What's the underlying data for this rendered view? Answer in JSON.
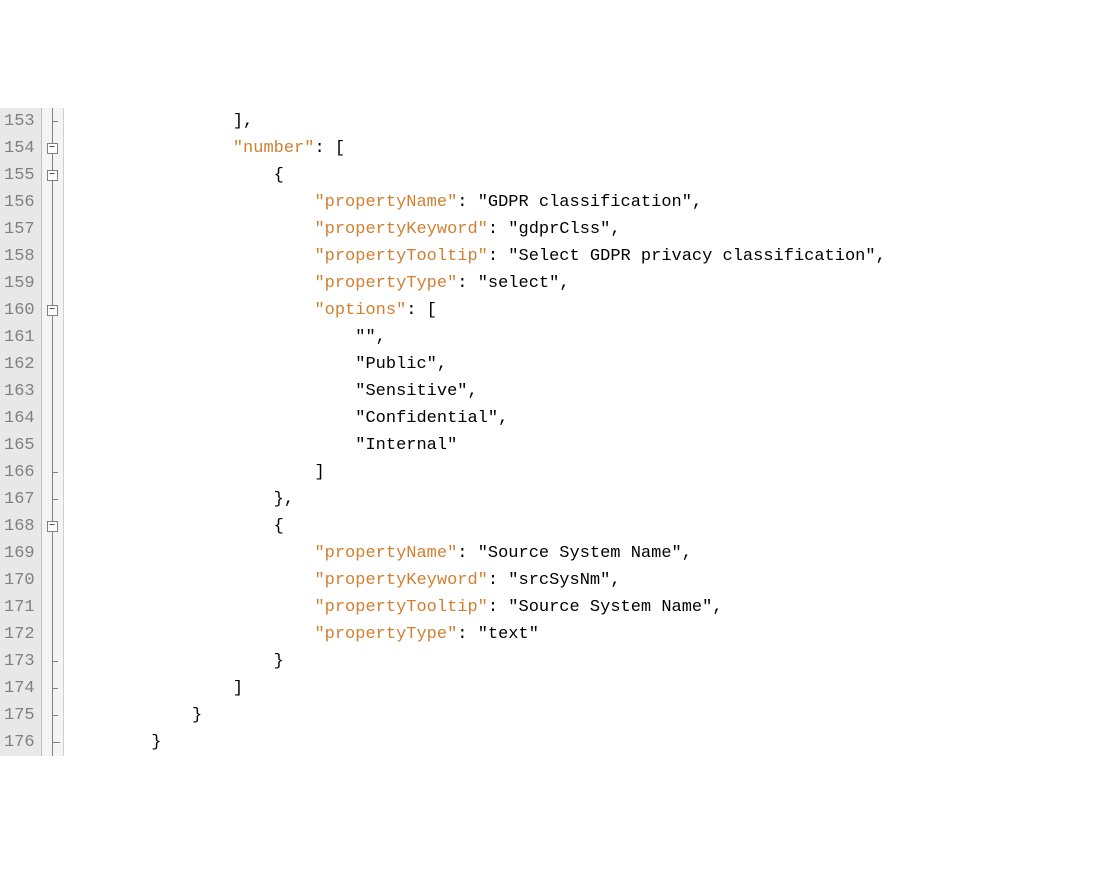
{
  "lines": [
    {
      "num": 153,
      "fold": "tick",
      "indent": 16,
      "tokens": [
        {
          "t": "punct",
          "v": "],"
        }
      ]
    },
    {
      "num": 154,
      "fold": "box",
      "indent": 16,
      "tokens": [
        {
          "t": "key",
          "v": "\"number\""
        },
        {
          "t": "punct",
          "v": ": ["
        }
      ]
    },
    {
      "num": 155,
      "fold": "box",
      "indent": 20,
      "tokens": [
        {
          "t": "punct",
          "v": "{"
        }
      ]
    },
    {
      "num": 156,
      "fold": "line",
      "indent": 24,
      "tokens": [
        {
          "t": "key",
          "v": "\"propertyName\""
        },
        {
          "t": "punct",
          "v": ": "
        },
        {
          "t": "string",
          "v": "\"GDPR classification\""
        },
        {
          "t": "punct",
          "v": ","
        }
      ]
    },
    {
      "num": 157,
      "fold": "line",
      "indent": 24,
      "tokens": [
        {
          "t": "key",
          "v": "\"propertyKeyword\""
        },
        {
          "t": "punct",
          "v": ": "
        },
        {
          "t": "string",
          "v": "\"gdprClss\""
        },
        {
          "t": "punct",
          "v": ","
        }
      ]
    },
    {
      "num": 158,
      "fold": "line",
      "indent": 24,
      "tokens": [
        {
          "t": "key",
          "v": "\"propertyTooltip\""
        },
        {
          "t": "punct",
          "v": ": "
        },
        {
          "t": "string",
          "v": "\"Select GDPR privacy classification\""
        },
        {
          "t": "punct",
          "v": ","
        }
      ]
    },
    {
      "num": 159,
      "fold": "line",
      "indent": 24,
      "tokens": [
        {
          "t": "key",
          "v": "\"propertyType\""
        },
        {
          "t": "punct",
          "v": ": "
        },
        {
          "t": "string",
          "v": "\"select\""
        },
        {
          "t": "punct",
          "v": ","
        }
      ]
    },
    {
      "num": 160,
      "fold": "box",
      "indent": 24,
      "tokens": [
        {
          "t": "key",
          "v": "\"options\""
        },
        {
          "t": "punct",
          "v": ": ["
        }
      ]
    },
    {
      "num": 161,
      "fold": "line",
      "indent": 28,
      "tokens": [
        {
          "t": "string",
          "v": "\"\""
        },
        {
          "t": "punct",
          "v": ","
        }
      ]
    },
    {
      "num": 162,
      "fold": "line",
      "indent": 28,
      "tokens": [
        {
          "t": "string",
          "v": "\"Public\""
        },
        {
          "t": "punct",
          "v": ","
        }
      ]
    },
    {
      "num": 163,
      "fold": "line",
      "indent": 28,
      "tokens": [
        {
          "t": "string",
          "v": "\"Sensitive\""
        },
        {
          "t": "punct",
          "v": ","
        }
      ]
    },
    {
      "num": 164,
      "fold": "line",
      "indent": 28,
      "tokens": [
        {
          "t": "string",
          "v": "\"Confidential\""
        },
        {
          "t": "punct",
          "v": ","
        }
      ]
    },
    {
      "num": 165,
      "fold": "line",
      "indent": 28,
      "tokens": [
        {
          "t": "string",
          "v": "\"Internal\""
        }
      ]
    },
    {
      "num": 166,
      "fold": "tick",
      "indent": 24,
      "tokens": [
        {
          "t": "punct",
          "v": "]"
        }
      ]
    },
    {
      "num": 167,
      "fold": "tick",
      "indent": 20,
      "tokens": [
        {
          "t": "punct",
          "v": "},"
        }
      ]
    },
    {
      "num": 168,
      "fold": "box",
      "indent": 20,
      "tokens": [
        {
          "t": "punct",
          "v": "{"
        }
      ]
    },
    {
      "num": 169,
      "fold": "line",
      "indent": 24,
      "tokens": [
        {
          "t": "key",
          "v": "\"propertyName\""
        },
        {
          "t": "punct",
          "v": ": "
        },
        {
          "t": "string",
          "v": "\"Source System Name\""
        },
        {
          "t": "punct",
          "v": ","
        }
      ]
    },
    {
      "num": 170,
      "fold": "line",
      "indent": 24,
      "tokens": [
        {
          "t": "key",
          "v": "\"propertyKeyword\""
        },
        {
          "t": "punct",
          "v": ": "
        },
        {
          "t": "string",
          "v": "\"srcSysNm\""
        },
        {
          "t": "punct",
          "v": ","
        }
      ]
    },
    {
      "num": 171,
      "fold": "line",
      "indent": 24,
      "tokens": [
        {
          "t": "key",
          "v": "\"propertyTooltip\""
        },
        {
          "t": "punct",
          "v": ": "
        },
        {
          "t": "string",
          "v": "\"Source System Name\""
        },
        {
          "t": "punct",
          "v": ","
        }
      ]
    },
    {
      "num": 172,
      "fold": "line",
      "indent": 24,
      "tokens": [
        {
          "t": "key",
          "v": "\"propertyType\""
        },
        {
          "t": "punct",
          "v": ": "
        },
        {
          "t": "string",
          "v": "\"text\""
        }
      ]
    },
    {
      "num": 173,
      "fold": "tick",
      "indent": 20,
      "tokens": [
        {
          "t": "punct",
          "v": "}"
        }
      ]
    },
    {
      "num": 174,
      "fold": "tick",
      "indent": 16,
      "tokens": [
        {
          "t": "punct",
          "v": "]"
        }
      ]
    },
    {
      "num": 175,
      "fold": "tick",
      "indent": 12,
      "tokens": [
        {
          "t": "punct",
          "v": "}"
        }
      ]
    },
    {
      "num": 176,
      "fold": "corner",
      "indent": 8,
      "tokens": [
        {
          "t": "punct",
          "v": "}"
        }
      ]
    }
  ]
}
